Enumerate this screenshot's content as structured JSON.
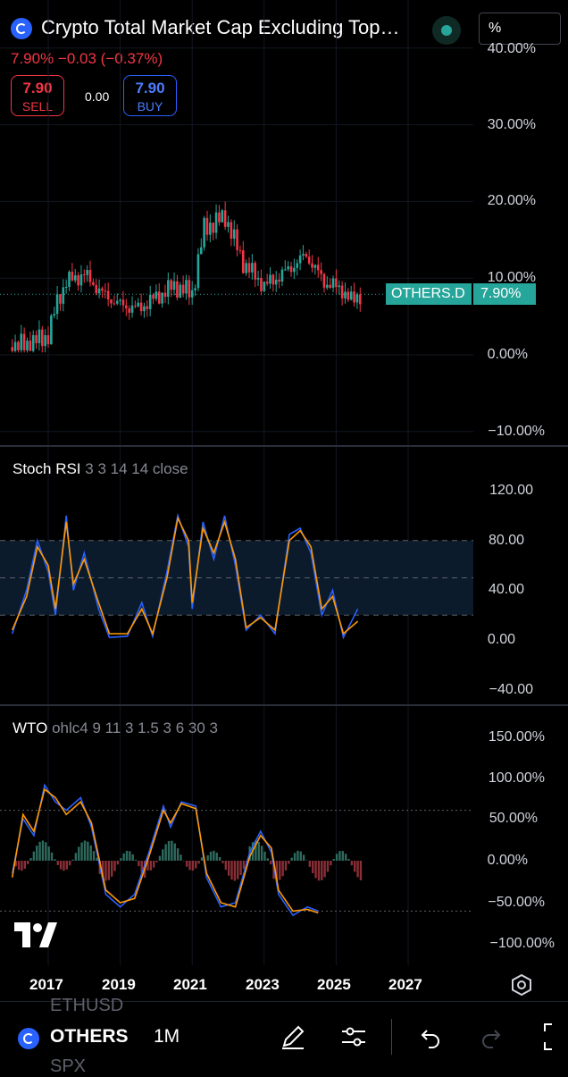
{
  "header": {
    "title": "Crypto Total Market Cap Excluding Top…",
    "unit_select": "%",
    "price_line": "7.90%  −0.03 (−0.37%)"
  },
  "trade": {
    "sell_price": "7.90",
    "sell_label": "SELL",
    "spread": "0.00",
    "buy_price": "7.90",
    "buy_label": "BUY"
  },
  "price_pane": {
    "symbol_tag": "OTHERS.D",
    "value_tag": "7.90%",
    "axis_labels": [
      "40.00%",
      "30.00%",
      "20.00%",
      "10.00%",
      "0.00%",
      "−10.00%"
    ]
  },
  "stoch_pane": {
    "name": "Stoch RSI",
    "params": "3 3 14 14 close",
    "axis_labels": [
      "120.00",
      "80.00",
      "40.00",
      "0.00",
      "−40.00"
    ]
  },
  "wto_pane": {
    "name": "WTO",
    "params": "ohlc4 9 11 3 1.5 3 6 30 3",
    "axis_labels": [
      "150.00%",
      "100.00%",
      "50.00%",
      "0.00%",
      "−50.00%",
      "−100.00%"
    ]
  },
  "x_axis": [
    "2017",
    "2019",
    "2021",
    "2023",
    "2025",
    "2027"
  ],
  "bottom_bar": {
    "ghost_top": "ETHUSD",
    "symbol": "OTHERS",
    "ghost_bottom": "SPX",
    "interval": "1M"
  },
  "colors": {
    "up": "#26a69a",
    "down": "#f23645",
    "k_line": "#2962ff",
    "d_line": "#ff9800"
  },
  "chart_data": [
    {
      "type": "candlestick",
      "title": "Crypto Total Market Cap Excluding Top…",
      "ylim": [
        -10,
        40
      ],
      "x_ticks": [
        "2017",
        "2019",
        "2021",
        "2023",
        "2025",
        "2027"
      ],
      "close_approx": [
        {
          "x": "2016-01",
          "y": 1.0
        },
        {
          "x": "2016-07",
          "y": 1.5
        },
        {
          "x": "2017-01",
          "y": 2.5
        },
        {
          "x": "2017-04",
          "y": 7.0
        },
        {
          "x": "2017-07",
          "y": 9.5
        },
        {
          "x": "2018-01",
          "y": 10.5
        },
        {
          "x": "2018-07",
          "y": 8.0
        },
        {
          "x": "2019-01",
          "y": 6.5
        },
        {
          "x": "2019-07",
          "y": 6.0
        },
        {
          "x": "2020-01",
          "y": 7.5
        },
        {
          "x": "2020-07",
          "y": 9.0
        },
        {
          "x": "2021-01",
          "y": 8.0
        },
        {
          "x": "2021-05",
          "y": 16.5
        },
        {
          "x": "2021-12",
          "y": 18.0
        },
        {
          "x": "2022-06",
          "y": 12.0
        },
        {
          "x": "2023-01",
          "y": 9.0
        },
        {
          "x": "2023-07",
          "y": 10.5
        },
        {
          "x": "2024-03",
          "y": 13.0
        },
        {
          "x": "2024-09",
          "y": 9.5
        },
        {
          "x": "2025-03",
          "y": 8.5
        },
        {
          "x": "2025-06",
          "y": 7.0
        },
        {
          "x": "2025-09",
          "y": 7.9
        }
      ],
      "last_value": "7.90%"
    },
    {
      "type": "line",
      "title": "Stoch RSI 3 3 14 14 close",
      "ylim": [
        -40,
        120
      ],
      "bands": [
        20,
        50,
        80
      ],
      "series": [
        {
          "values": [
            [
              2016.0,
              5
            ],
            [
              2016.4,
              40
            ],
            [
              2016.7,
              80
            ],
            [
              2017.0,
              55
            ],
            [
              2017.2,
              20
            ],
            [
              2017.5,
              100
            ],
            [
              2017.7,
              40
            ],
            [
              2018.0,
              70
            ],
            [
              2018.4,
              25
            ],
            [
              2018.7,
              2
            ],
            [
              2019.2,
              3
            ],
            [
              2019.6,
              30
            ],
            [
              2019.9,
              3
            ],
            [
              2020.3,
              55
            ],
            [
              2020.6,
              100
            ],
            [
              2020.9,
              75
            ],
            [
              2021.0,
              25
            ],
            [
              2021.3,
              95
            ],
            [
              2021.6,
              65
            ],
            [
              2021.9,
              100
            ],
            [
              2022.2,
              60
            ],
            [
              2022.5,
              8
            ],
            [
              2022.9,
              20
            ],
            [
              2023.3,
              5
            ],
            [
              2023.7,
              85
            ],
            [
              2024.0,
              90
            ],
            [
              2024.3,
              70
            ],
            [
              2024.6,
              20
            ],
            [
              2024.9,
              40
            ],
            [
              2025.2,
              2
            ],
            [
              2025.6,
              25
            ]
          ]
        },
        {
          "values": [
            [
              2016.0,
              8
            ],
            [
              2016.4,
              35
            ],
            [
              2016.7,
              75
            ],
            [
              2017.0,
              60
            ],
            [
              2017.2,
              25
            ],
            [
              2017.5,
              95
            ],
            [
              2017.7,
              45
            ],
            [
              2018.0,
              65
            ],
            [
              2018.4,
              30
            ],
            [
              2018.7,
              5
            ],
            [
              2019.2,
              5
            ],
            [
              2019.6,
              25
            ],
            [
              2019.9,
              5
            ],
            [
              2020.3,
              50
            ],
            [
              2020.6,
              98
            ],
            [
              2020.9,
              80
            ],
            [
              2021.0,
              30
            ],
            [
              2021.3,
              90
            ],
            [
              2021.6,
              70
            ],
            [
              2021.9,
              95
            ],
            [
              2022.2,
              65
            ],
            [
              2022.5,
              10
            ],
            [
              2022.9,
              18
            ],
            [
              2023.3,
              8
            ],
            [
              2023.7,
              80
            ],
            [
              2024.0,
              88
            ],
            [
              2024.3,
              75
            ],
            [
              2024.6,
              25
            ],
            [
              2024.9,
              35
            ],
            [
              2025.2,
              5
            ],
            [
              2025.6,
              15
            ]
          ]
        }
      ]
    },
    {
      "type": "line",
      "title": "WTO ohlc4 9 11 3 1.5 3 6 30 3",
      "ylim": [
        -100,
        150
      ],
      "levels": [
        60,
        -60
      ],
      "series": [
        {
          "values": [
            [
              2016.0,
              -15
            ],
            [
              2016.3,
              50
            ],
            [
              2016.6,
              30
            ],
            [
              2016.9,
              90
            ],
            [
              2017.2,
              70
            ],
            [
              2017.5,
              60
            ],
            [
              2017.9,
              75
            ],
            [
              2018.2,
              40
            ],
            [
              2018.6,
              -40
            ],
            [
              2019.0,
              -55
            ],
            [
              2019.4,
              -40
            ],
            [
              2019.8,
              10
            ],
            [
              2020.2,
              65
            ],
            [
              2020.4,
              40
            ],
            [
              2020.7,
              70
            ],
            [
              2021.1,
              65
            ],
            [
              2021.4,
              -20
            ],
            [
              2021.8,
              -55
            ],
            [
              2022.2,
              -50
            ],
            [
              2022.6,
              10
            ],
            [
              2022.9,
              35
            ],
            [
              2023.2,
              10
            ],
            [
              2023.4,
              -40
            ],
            [
              2023.8,
              -65
            ],
            [
              2024.2,
              -55
            ],
            [
              2024.5,
              -60
            ]
          ]
        },
        {
          "values": [
            [
              2016.0,
              -20
            ],
            [
              2016.3,
              55
            ],
            [
              2016.6,
              35
            ],
            [
              2016.9,
              85
            ],
            [
              2017.2,
              75
            ],
            [
              2017.5,
              55
            ],
            [
              2017.9,
              70
            ],
            [
              2018.2,
              45
            ],
            [
              2018.6,
              -35
            ],
            [
              2019.0,
              -50
            ],
            [
              2019.4,
              -45
            ],
            [
              2019.8,
              5
            ],
            [
              2020.2,
              60
            ],
            [
              2020.4,
              45
            ],
            [
              2020.7,
              68
            ],
            [
              2021.1,
              62
            ],
            [
              2021.4,
              -15
            ],
            [
              2021.8,
              -50
            ],
            [
              2022.2,
              -55
            ],
            [
              2022.6,
              5
            ],
            [
              2022.9,
              30
            ],
            [
              2023.2,
              15
            ],
            [
              2023.4,
              -35
            ],
            [
              2023.8,
              -60
            ],
            [
              2024.2,
              -58
            ],
            [
              2024.5,
              -62
            ]
          ]
        }
      ]
    }
  ]
}
